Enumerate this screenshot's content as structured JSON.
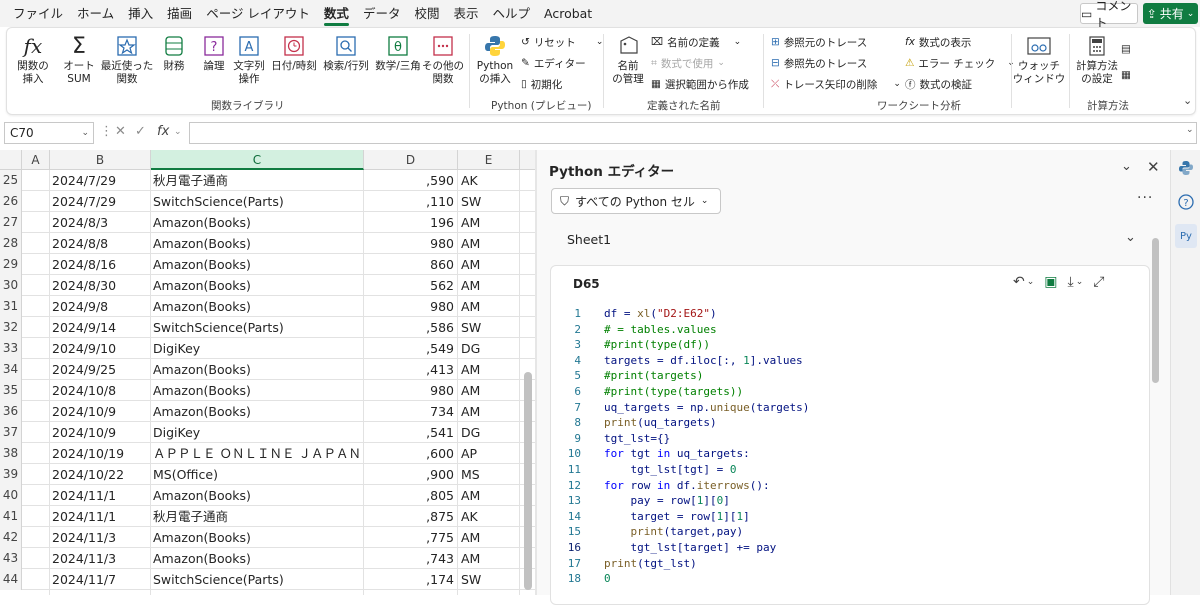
{
  "menu": {
    "tabs": [
      "ファイル",
      "ホーム",
      "挿入",
      "描画",
      "ページ レイアウト",
      "数式",
      "データ",
      "校閲",
      "表示",
      "ヘルプ",
      "Acrobat"
    ],
    "active_tab": "数式",
    "comment_label": "コメント",
    "share_label": "共有"
  },
  "ribbon": {
    "function_library": {
      "insert_function": "関数の\n挿入",
      "autosum": "オート\nSUM",
      "recent": "最近使った\n関数",
      "financial": "財務",
      "logical": "論理",
      "text": "文字列\n操作",
      "datetime": "日付/時刻",
      "lookup": "検索/行列",
      "math": "数学/三角",
      "more": "その他の\n関数",
      "group_label": "関数ライブラリ"
    },
    "python": {
      "insert": "Python\nの挿入",
      "reset": "リセット",
      "editor": "エディター",
      "initialize": "初期化",
      "group_label": "Python (プレビュー)"
    },
    "defined_names": {
      "name_manager": "名前\nの管理",
      "define_name": "名前の定義",
      "use_in_formula": "数式で使用",
      "create_from_selection": "選択範囲から作成",
      "group_label": "定義された名前"
    },
    "formula_auditing": {
      "trace_precedents": "参照元のトレース",
      "trace_dependents": "参照先のトレース",
      "remove_arrows": "トレース矢印の削除",
      "show_formulas": "数式の表示",
      "error_checking": "エラー チェック",
      "evaluate_formula": "数式の検証",
      "watch_window": "ウォッチ\nウィンドウ",
      "group_label": "ワークシート分析"
    },
    "calculation": {
      "calc_options": "計算方法\nの設定",
      "group_label": "計算方法"
    }
  },
  "formula_bar": {
    "name_box": "C70",
    "formula": ""
  },
  "grid": {
    "columns": [
      "A",
      "B",
      "C",
      "D",
      "E"
    ],
    "selected_column": "C",
    "rows": [
      {
        "num": "25",
        "date": "2024/7/29",
        "vendor": "秋月電子通商",
        "amount": ",590",
        "code": "AK"
      },
      {
        "num": "26",
        "date": "2024/7/29",
        "vendor": "SwitchScience(Parts)",
        "amount": ",110",
        "code": "SW"
      },
      {
        "num": "27",
        "date": "2024/8/3",
        "vendor": "Amazon(Books)",
        "amount": "196",
        "code": "AM"
      },
      {
        "num": "28",
        "date": "2024/8/8",
        "vendor": "Amazon(Books)",
        "amount": "980",
        "code": "AM"
      },
      {
        "num": "29",
        "date": "2024/8/16",
        "vendor": "Amazon(Books)",
        "amount": "860",
        "code": "AM"
      },
      {
        "num": "30",
        "date": "2024/8/30",
        "vendor": "Amazon(Books)",
        "amount": "562",
        "code": "AM"
      },
      {
        "num": "31",
        "date": "2024/9/8",
        "vendor": "Amazon(Books)",
        "amount": "980",
        "code": "AM"
      },
      {
        "num": "32",
        "date": "2024/9/14",
        "vendor": "SwitchScience(Parts)",
        "amount": ",586",
        "code": "SW"
      },
      {
        "num": "33",
        "date": "2024/9/10",
        "vendor": "DigiKey",
        "amount": ",549",
        "code": "DG"
      },
      {
        "num": "34",
        "date": "2024/9/25",
        "vendor": "Amazon(Books)",
        "amount": ",413",
        "code": "AM"
      },
      {
        "num": "35",
        "date": "2024/10/8",
        "vendor": "Amazon(Books)",
        "amount": "980",
        "code": "AM"
      },
      {
        "num": "36",
        "date": "2024/10/9",
        "vendor": "Amazon(Books)",
        "amount": "734",
        "code": "AM"
      },
      {
        "num": "37",
        "date": "2024/10/9",
        "vendor": "DigiKey",
        "amount": ",541",
        "code": "DG"
      },
      {
        "num": "38",
        "date": "2024/10/19",
        "vendor": "ＡＰＰＬＥ ＯＮＬＩＮＥ ＪＡＰＡＮ",
        "amount": ",600",
        "code": "AP"
      },
      {
        "num": "39",
        "date": "2024/10/22",
        "vendor": "MS(Office)",
        "amount": ",900",
        "code": "MS"
      },
      {
        "num": "40",
        "date": "2024/11/1",
        "vendor": "Amazon(Books)",
        "amount": ",805",
        "code": "AM"
      },
      {
        "num": "41",
        "date": "2024/11/1",
        "vendor": "秋月電子通商",
        "amount": ",875",
        "code": "AK"
      },
      {
        "num": "42",
        "date": "2024/11/3",
        "vendor": "Amazon(Books)",
        "amount": ",775",
        "code": "AM"
      },
      {
        "num": "43",
        "date": "2024/11/3",
        "vendor": "Amazon(Books)",
        "amount": ",743",
        "code": "AM"
      },
      {
        "num": "44",
        "date": "2024/11/7",
        "vendor": "SwitchScience(Parts)",
        "amount": ",174",
        "code": "SW"
      }
    ]
  },
  "python_editor": {
    "title": "Python エディター",
    "filter_label": "すべての Python セル",
    "sheet_name": "Sheet1",
    "cell_ref": "D65",
    "code_lines": [
      "df = xl(\"D2:E62\")",
      "# = tables.values",
      "#print(type(df))",
      "targets = df.iloc[:, 1].values",
      "#print(targets)",
      "#print(type(targets))",
      "uq_targets = np.unique(targets)",
      "print(uq_targets)",
      "tgt_lst={}",
      "for tgt in uq_targets:",
      "    tgt_lst[tgt] = 0",
      "for row in df.iterrows():",
      "    pay = row[1][0]",
      "    target = row[1][1]",
      "    print(target,pay)",
      "    tgt_lst[target] += pay",
      "print(tgt_lst)",
      "0"
    ],
    "current_line": 16
  },
  "icons": {
    "insert_function": "fx-icon",
    "autosum": "sigma-icon",
    "python": "python-logo-icon"
  },
  "colors": {
    "accent": "#107c41",
    "keyword": "#0000ff",
    "string": "#a31515",
    "number": "#098658",
    "comment": "#008000"
  }
}
